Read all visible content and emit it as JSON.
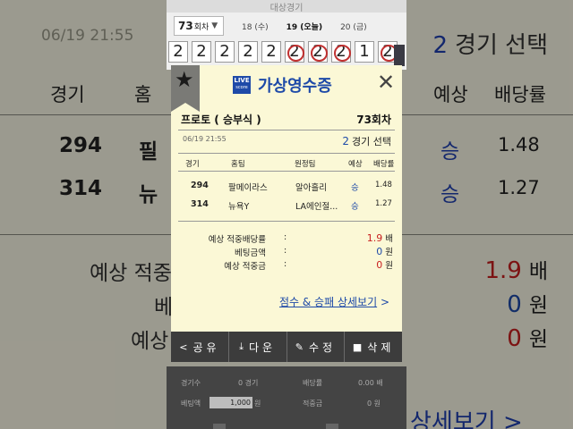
{
  "background": {
    "date": "06/19  21:55",
    "selected_count": "2",
    "selected_label": "경기 선택",
    "headers": {
      "game": "경기",
      "home": "홈",
      "pred": "예상",
      "odds": "배당률"
    },
    "rows": [
      {
        "no": "294",
        "home": "필",
        "pred": "승",
        "odds": "1.48"
      },
      {
        "no": "314",
        "home": "뉴",
        "pred": "승",
        "odds": "1.27"
      }
    ],
    "summary": [
      {
        "label": "예상 적중",
        "value": "1.9",
        "unit": "배"
      },
      {
        "label": "베",
        "value": "0",
        "unit": "원"
      },
      {
        "label": "예상",
        "value": "0",
        "unit": "원"
      }
    ],
    "link": "상세보기 >"
  },
  "strip": {
    "top_text": "대상경기",
    "round": "73",
    "round_suffix": "회차",
    "days": [
      "18 (수)",
      "19 (오늘)",
      "20 (금)"
    ],
    "picks": [
      "2",
      "2",
      "2",
      "2",
      "2",
      "2",
      "2",
      "2",
      "1",
      "2"
    ]
  },
  "modal": {
    "logo_top": "LIVE",
    "logo_bottom": "score",
    "title": "가상영수증",
    "close_glyph": "✕",
    "star_glyph": "★",
    "game_type": "프로토 ( 승부식 )",
    "round": "73회차",
    "date": "06/19  21:55",
    "selected_count": "2",
    "selected_label": "경기 선택",
    "headers": {
      "game": "경기",
      "home": "홈팀",
      "away": "원정팀",
      "pred": "예상",
      "odds": "배당률"
    },
    "rows": [
      {
        "no": "294",
        "home": "팔메이라스",
        "away": "알아흘리",
        "pred": "승",
        "odds": "1.48"
      },
      {
        "no": "314",
        "home": "뉴욕Y",
        "away": "LA에인절...",
        "pred": "승",
        "odds": "1.27"
      }
    ],
    "summary": [
      {
        "label": "예상 적중배당률",
        "colon": ":",
        "value": "1.9",
        "unit": "배"
      },
      {
        "label": "베팅금액",
        "colon": ":",
        "value": "0",
        "unit": "원"
      },
      {
        "label": "예상 적중금",
        "colon": ":",
        "value": "0",
        "unit": "원"
      }
    ],
    "link_text": "점수 & 승패 상세보기",
    "link_arrow": ">",
    "colors": {
      "accent": "#1e4aa8",
      "red": "#c82020",
      "paper": "#fbf8d6"
    }
  },
  "actions": [
    {
      "icon": "<",
      "label": "공유"
    },
    {
      "icon": "⤓",
      "label": "다운"
    },
    {
      "icon": "✎",
      "label": "수정"
    },
    {
      "icon": "■",
      "label": "삭제"
    }
  ],
  "bottom": {
    "games_label": "경기수",
    "games_value": "0 경기",
    "odds_label": "배당률",
    "odds_value": "0.00 배",
    "bet_label": "베팅액",
    "bet_value": "1,000",
    "bet_unit": "원",
    "win_label": "적중금",
    "win_value": "0 원"
  }
}
